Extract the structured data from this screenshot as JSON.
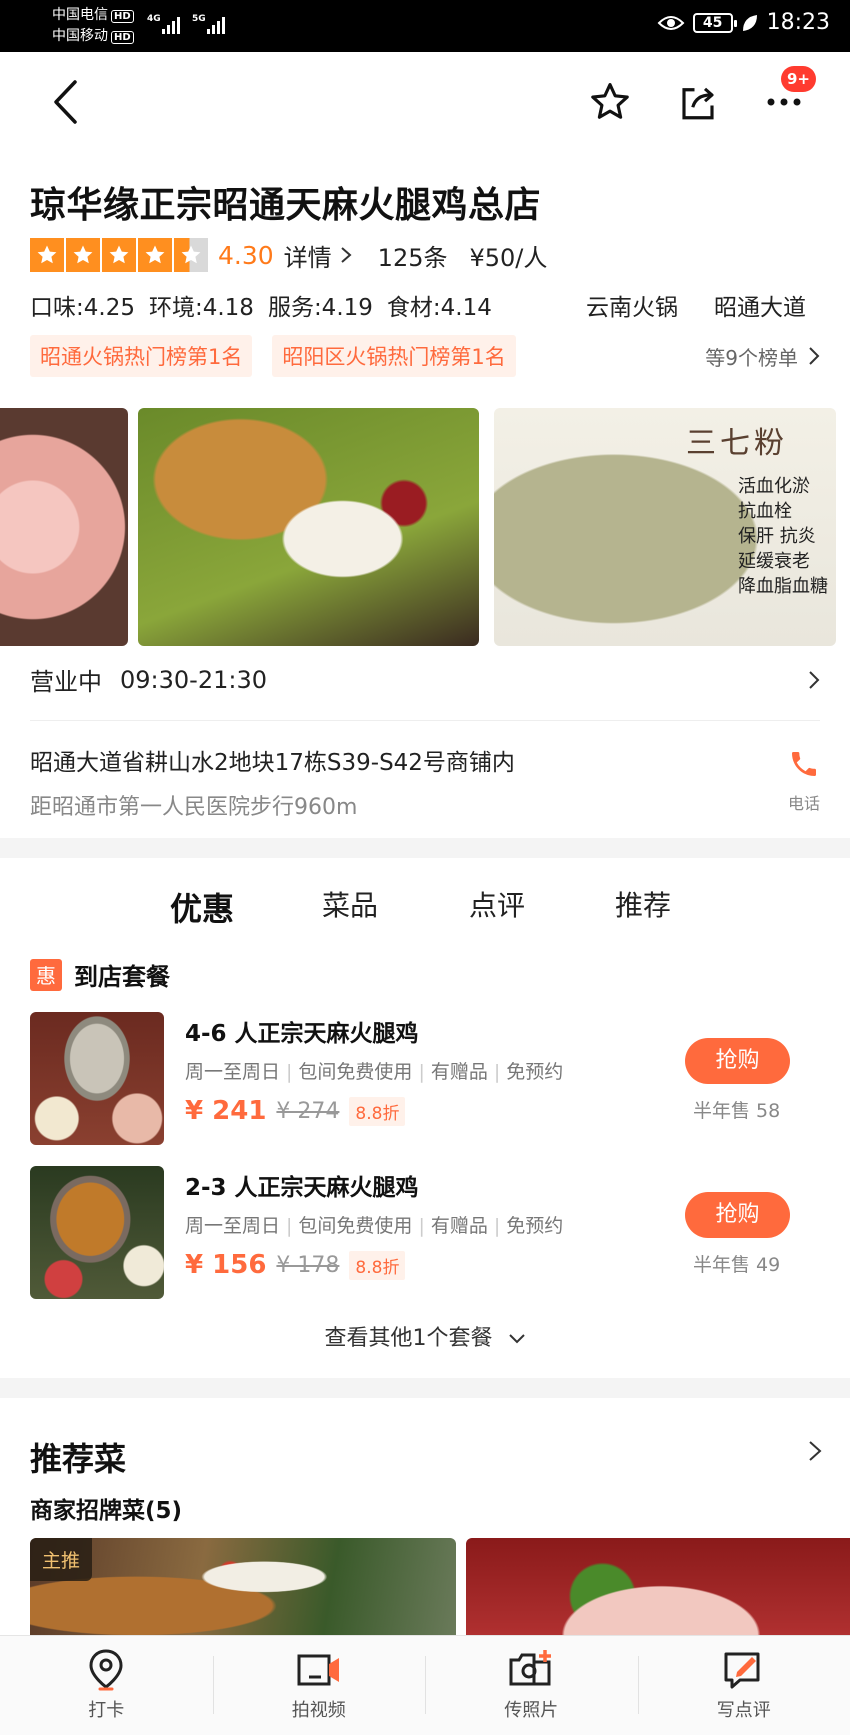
{
  "status_bar": {
    "carrier1": "中国电信",
    "carrier2": "中国移动",
    "hd": "HD",
    "network1": "4G",
    "network2": "5G",
    "battery": "45",
    "time": "18:23"
  },
  "nav": {
    "badge": "9+"
  },
  "shop": {
    "name": "琼华缘正宗昭通天麻火腿鸡总店",
    "score": "4.30",
    "star_rating": 4.3,
    "details_link": "详情",
    "review_count": "125条",
    "price_per_person": "¥50/人",
    "sub_scores": [
      "口味:4.25",
      "环境:4.18",
      "服务:4.19",
      "食材:4.14"
    ],
    "category": "云南火锅",
    "district": "昭通大道",
    "ranks": [
      "昭通火锅热门榜第1名",
      "昭阳区火锅热门榜第1名"
    ],
    "ranks_more": "等9个榜单"
  },
  "photos": {
    "photo3_title": "三七粉",
    "photo3_lines": [
      "活血化淤",
      "抗血栓",
      "保肝 抗炎",
      "延缓衰老",
      "降血脂血糖"
    ]
  },
  "info": {
    "status": "营业中",
    "hours": "09:30-21:30",
    "address": "昭通大道省耕山水2地块17栋S39-S42号商铺内",
    "distance": "距昭通市第一人民医院步行960m",
    "phone_label": "电话"
  },
  "tabs": [
    "优惠",
    "菜品",
    "点评",
    "推荐"
  ],
  "deals": {
    "badge": "惠",
    "header": "到店套餐",
    "items": [
      {
        "title": "4-6 人正宗天麻火腿鸡",
        "tags": [
          "周一至周日",
          "包间免费使用",
          "有赠品",
          "免预约"
        ],
        "price": "¥ 241",
        "original_price": "¥ 274",
        "discount": "8.8折",
        "button": "抢购",
        "sold": "半年售 58"
      },
      {
        "title": "2-3 人正宗天麻火腿鸡",
        "tags": [
          "周一至周日",
          "包间免费使用",
          "有赠品",
          "免预约"
        ],
        "price": "¥ 156",
        "original_price": "¥ 178",
        "discount": "8.8折",
        "button": "抢购",
        "sold": "半年售 49"
      }
    ],
    "more": "查看其他1个套餐"
  },
  "recommend": {
    "title": "推荐菜",
    "subtitle": "商家招牌菜(5)",
    "main_badge": "主推"
  },
  "bottom_bar": [
    "打卡",
    "拍视频",
    "传照片",
    "写点评"
  ],
  "colors": {
    "accent": "#ff6a3d",
    "star": "#ff8f1f",
    "rank_bg": "#fff1ea"
  }
}
